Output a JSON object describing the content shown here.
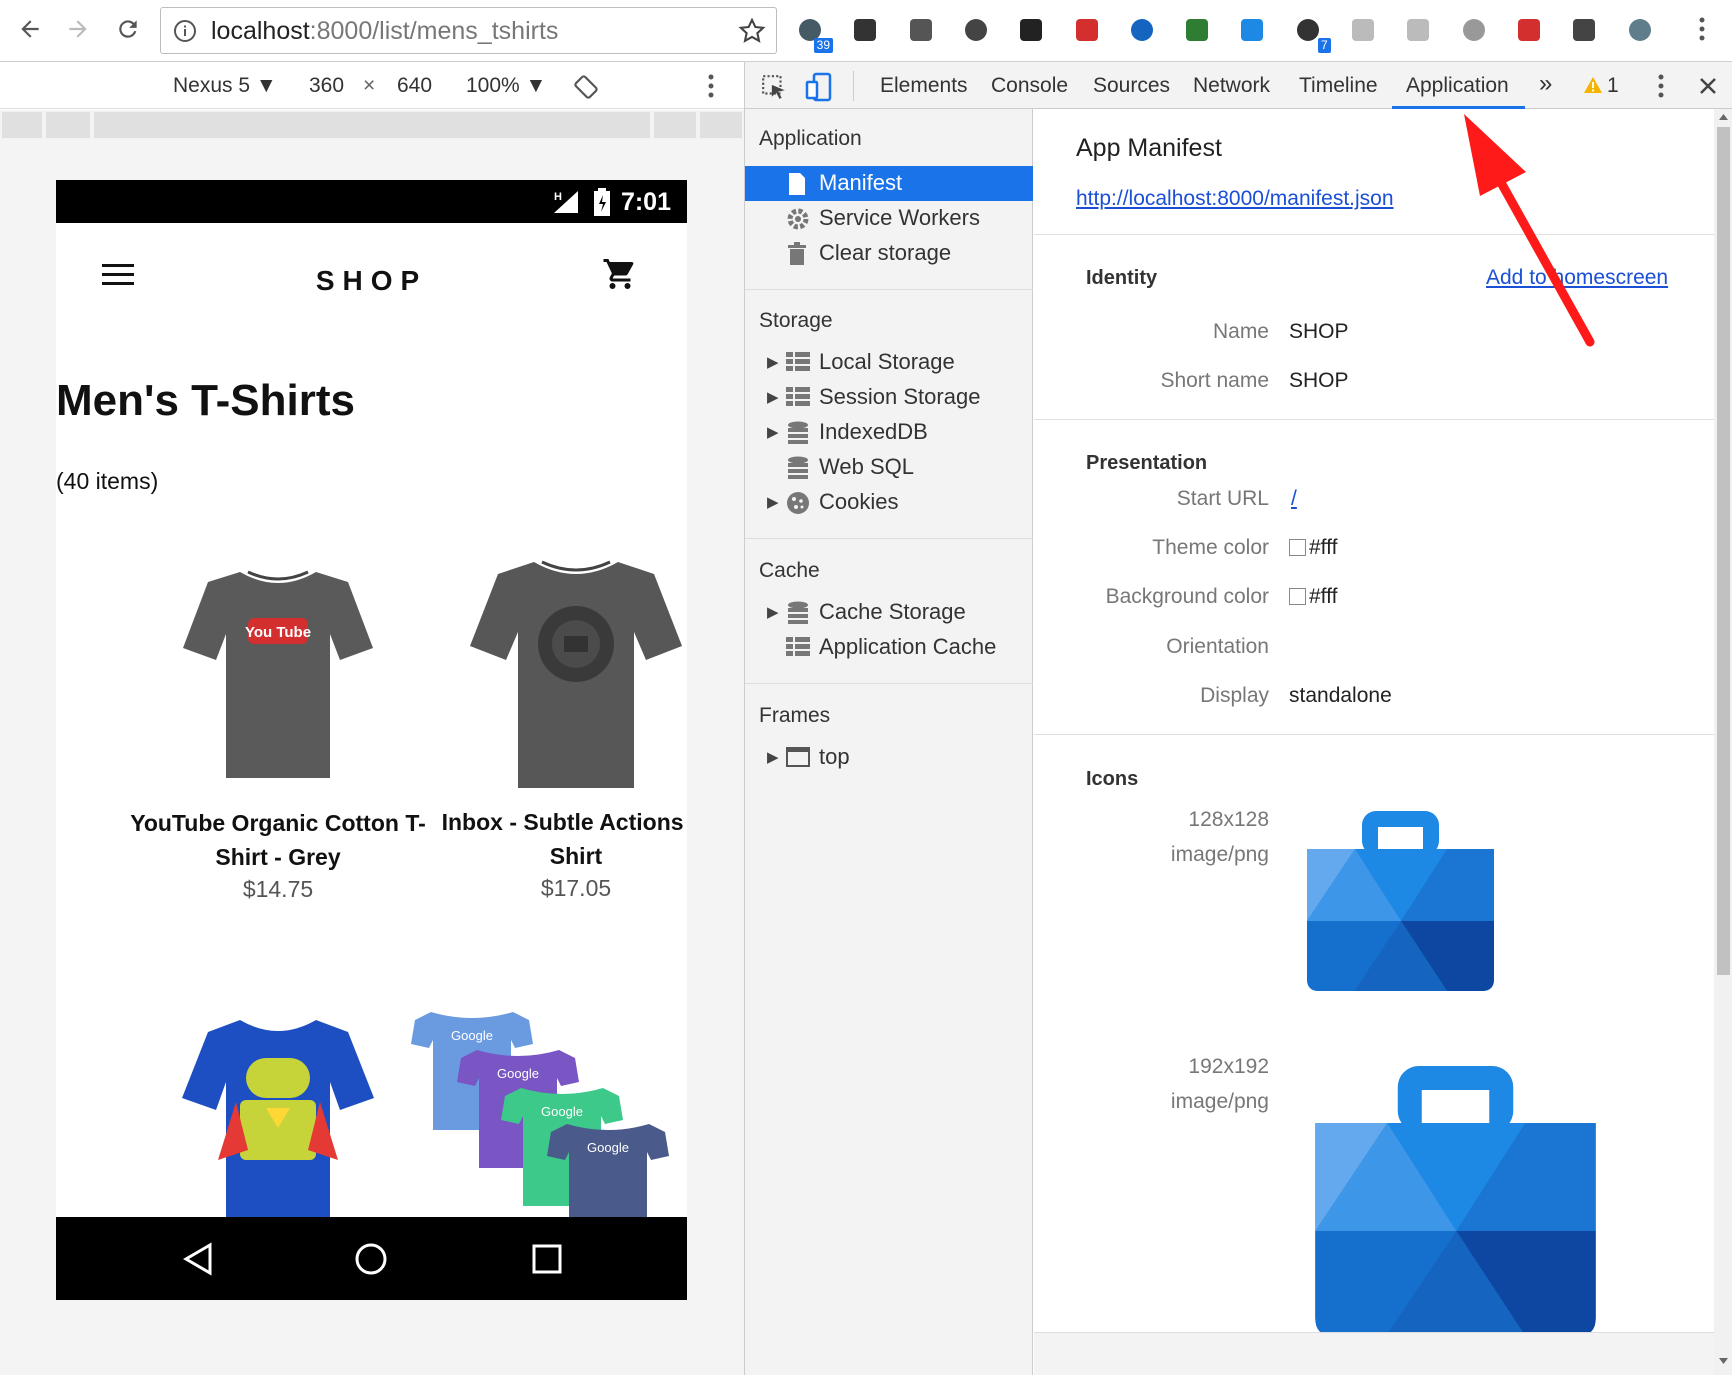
{
  "browser": {
    "url_host": "localhost",
    "url_rest": ":8000/list/mens_tshirts",
    "extensions": [
      {
        "icon": "todo-badge-icon",
        "badge": "39"
      },
      {
        "icon": "ghostery-icon",
        "badge": ""
      },
      {
        "icon": "eyedropper-icon",
        "badge": ""
      },
      {
        "icon": "pocket-icon",
        "badge": ""
      },
      {
        "icon": "incognito-icon",
        "badge": ""
      },
      {
        "icon": "acrobat-icon",
        "badge": ""
      },
      {
        "icon": "vimium-icon",
        "badge": ""
      },
      {
        "icon": "refresh-green-icon",
        "badge": ""
      },
      {
        "icon": "window-resizer-icon",
        "badge": ""
      },
      {
        "icon": "signal-hand-icon",
        "badge": "7"
      },
      {
        "icon": "shield-grey-icon",
        "badge": ""
      },
      {
        "icon": "raw-icon",
        "badge": ""
      },
      {
        "icon": "camera-icon",
        "badge": ""
      },
      {
        "icon": "cors-icon",
        "badge": ""
      },
      {
        "icon": "translate-icon",
        "badge": ""
      },
      {
        "icon": "avatar-icon",
        "badge": ""
      }
    ]
  },
  "device_toolbar": {
    "device": "Nexus 5",
    "width": "360",
    "times": "×",
    "height": "640",
    "zoom": "100%"
  },
  "phone": {
    "time": "7:01",
    "shop_title": "SHOP",
    "page_title": "Men's T-Shirts",
    "item_count": "(40 items)",
    "products": [
      {
        "name": "YouTube Organic Cotton T-Shirt - Grey",
        "price": "$14.75",
        "image": "tshirt-youtube-grey"
      },
      {
        "name": "Inbox - Subtle Actions T-Shirt",
        "price": "$17.05",
        "image": "tshirt-inbox-grey"
      },
      {
        "name": "",
        "price": "",
        "image": "tshirt-android-blue"
      },
      {
        "name": "",
        "price": "",
        "image": "tshirts-google-multicolor"
      }
    ],
    "product_image_text": {
      "youtube": "You Tube",
      "google": "Google"
    }
  },
  "devtools": {
    "tabs": [
      "Elements",
      "Console",
      "Sources",
      "Network",
      "Timeline",
      "Application"
    ],
    "active_tab": "Application",
    "more_tabs": "»",
    "warning_count": "1",
    "sidebar": {
      "application_header": "Application",
      "application_items": [
        "Manifest",
        "Service Workers",
        "Clear storage"
      ],
      "storage_header": "Storage",
      "storage_items": [
        "Local Storage",
        "Session Storage",
        "IndexedDB",
        "Web SQL",
        "Cookies"
      ],
      "cache_header": "Cache",
      "cache_items": [
        "Cache Storage",
        "Application Cache"
      ],
      "frames_header": "Frames",
      "frames_items": [
        "top"
      ]
    },
    "manifest": {
      "title": "App Manifest",
      "url": "http://localhost:8000/manifest.json",
      "identity_header": "Identity",
      "add_to_homescreen": "Add to homescreen",
      "name_label": "Name",
      "name_value": "SHOP",
      "short_name_label": "Short name",
      "short_name_value": "SHOP",
      "presentation_header": "Presentation",
      "start_url_label": "Start URL",
      "start_url_value": "/",
      "theme_color_label": "Theme color",
      "theme_color_value": "#fff",
      "background_color_label": "Background color",
      "background_color_value": "#fff",
      "orientation_label": "Orientation",
      "orientation_value": "",
      "display_label": "Display",
      "display_value": "standalone",
      "icons_header": "Icons",
      "icons": [
        {
          "size": "128x128",
          "type": "image/png"
        },
        {
          "size": "192x192",
          "type": "image/png"
        }
      ]
    }
  },
  "colors": {
    "accent": "#1a73e8",
    "arrow": "#ff0000",
    "icon_blue": "#1e88e5"
  }
}
